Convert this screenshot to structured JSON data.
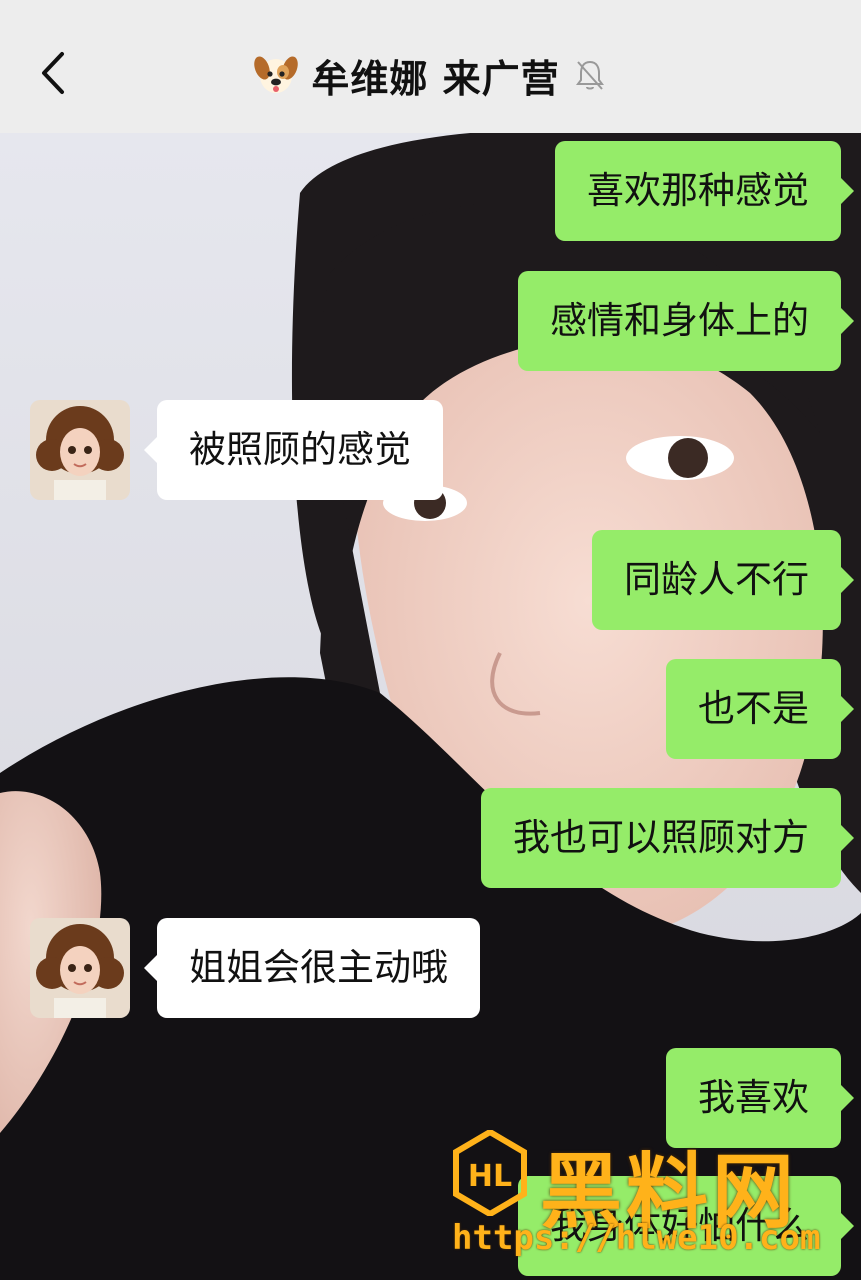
{
  "header": {
    "title": "牟维娜 来广营",
    "icons": {
      "back": "chevron-left-icon",
      "emoji": "dog-face-icon",
      "muted": "bell-muted-icon"
    }
  },
  "messages": [
    {
      "side": "me",
      "text": "喜欢那种感觉"
    },
    {
      "side": "me",
      "text": "感情和身体上的"
    },
    {
      "side": "other",
      "text": "被照顾的感觉"
    },
    {
      "side": "me",
      "text": "同龄人不行"
    },
    {
      "side": "me",
      "text": "也不是"
    },
    {
      "side": "me",
      "text": "我也可以照顾对方"
    },
    {
      "side": "other",
      "text": "姐姐会很主动哦"
    },
    {
      "side": "me",
      "text": "我喜欢"
    },
    {
      "side": "me",
      "text": "我身体好怕什么"
    }
  ],
  "watermark": {
    "brand": "黑料网",
    "url": "https://hlwe10.com",
    "logo": "HL"
  },
  "colors": {
    "my_bubble": "#95ec69",
    "other_bubble": "#ffffff",
    "header": "#ededed",
    "watermark": "#ffb21a"
  }
}
